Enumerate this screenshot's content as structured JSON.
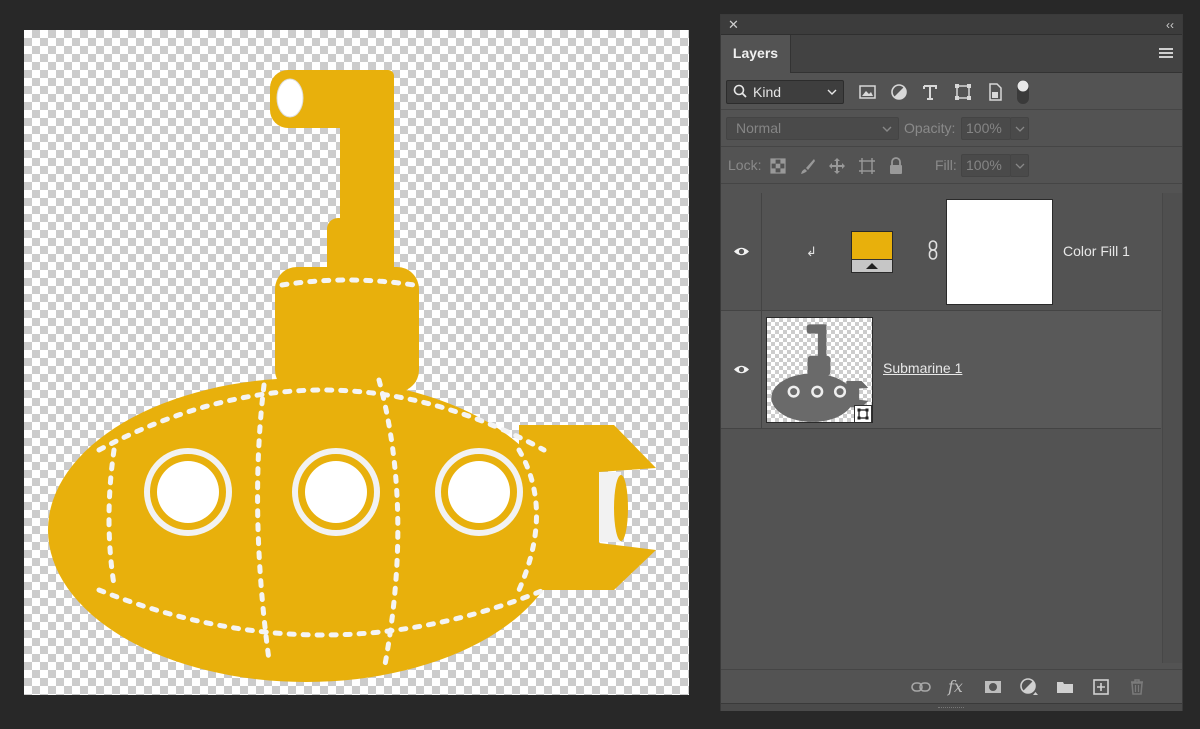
{
  "canvas": {
    "artwork": "yellow-submarine",
    "fill_color": "#E8B00C"
  },
  "panel": {
    "tab_label": "Layers",
    "close_glyph": "✕",
    "collapse_glyph": "‹‹",
    "filter": {
      "kind_label": "Kind",
      "icons": [
        "image-filter-icon",
        "adjustment-filter-icon",
        "type-filter-icon",
        "shape-filter-icon",
        "smart-object-filter-icon"
      ]
    },
    "blend": {
      "mode": "Normal",
      "opacity_label": "Opacity:",
      "opacity_value": "100%"
    },
    "lock": {
      "label": "Lock:",
      "icons": [
        "lock-transparent-icon",
        "lock-image-icon",
        "lock-position-icon",
        "lock-artboard-icon",
        "lock-all-icon"
      ],
      "fill_label": "Fill:",
      "fill_value": "100%"
    },
    "layers": [
      {
        "name": "Color Fill 1",
        "type": "fill",
        "visible": true,
        "clipped": true,
        "fill_color": "#E8B00C",
        "mask_color": "#FFFFFF"
      },
      {
        "name": "Submarine 1",
        "type": "smart-object",
        "visible": true,
        "selected": true
      }
    ],
    "bottom_icons": [
      "link-layers-icon",
      "fx-icon",
      "add-mask-icon",
      "new-adjustment-icon",
      "new-group-icon",
      "new-layer-icon",
      "delete-icon"
    ],
    "fx_label": "fx"
  }
}
